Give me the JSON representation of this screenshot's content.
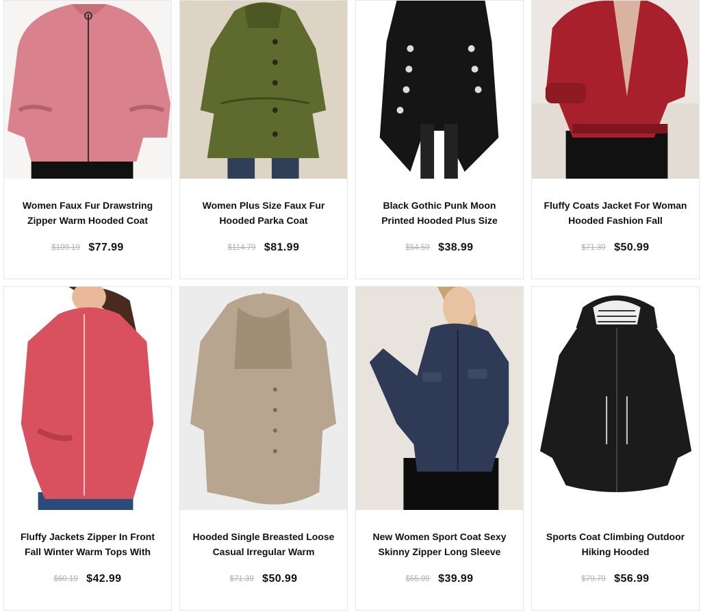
{
  "products": [
    {
      "title": "Women Faux Fur Drawstring Zipper Warm Hooded Coat",
      "old_price": "$109.19",
      "price": "$77.99"
    },
    {
      "title": "Women Plus Size Faux Fur Hooded Parka Coat",
      "old_price": "$114.79",
      "price": "$81.99"
    },
    {
      "title": "Black Gothic Punk Moon Printed Hooded Plus Size",
      "old_price": "$54.59",
      "price": "$38.99"
    },
    {
      "title": "Fluffy Coats Jacket For Woman Hooded Fashion Fall",
      "old_price": "$71.39",
      "price": "$50.99"
    },
    {
      "title": "Fluffy Jackets Zipper In Front Fall Winter Warm Tops With",
      "old_price": "$60.19",
      "price": "$42.99"
    },
    {
      "title": "Hooded Single Breasted Loose Casual Irregular Warm",
      "old_price": "$71.39",
      "price": "$50.99"
    },
    {
      "title": "New Women Sport Coat Sexy Skinny Zipper Long Sleeve",
      "old_price": "$55.99",
      "price": "$39.99"
    },
    {
      "title": "Sports Coat Climbing Outdoor Hiking Hooded",
      "old_price": "$79.79",
      "price": "$56.99"
    }
  ],
  "colors": {
    "pink_fur": "#d9818c",
    "olive_parka": "#5f6b2e",
    "black_gothic": "#151515",
    "red_fur": "#a8202c",
    "coral_fleece": "#d9505f",
    "beige_fleece": "#b7a58f",
    "navy_sport": "#2f3a56",
    "black_hiking": "#1b1b1b"
  }
}
